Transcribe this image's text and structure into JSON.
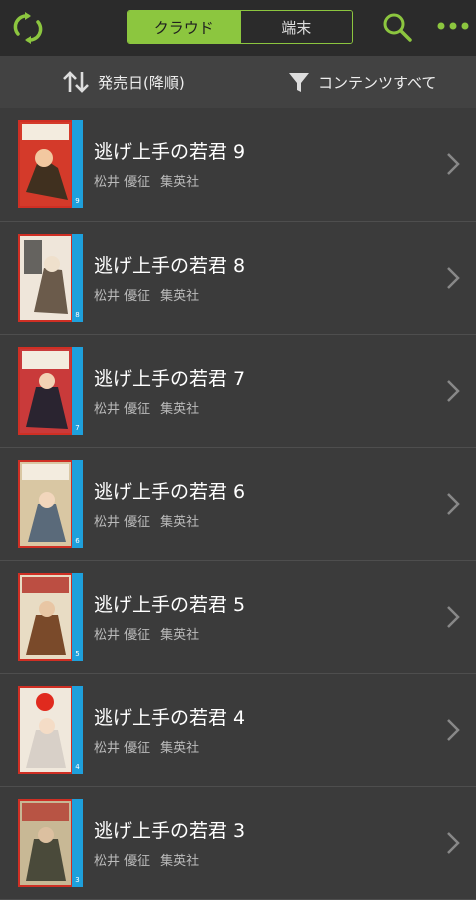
{
  "header": {
    "tabs": [
      {
        "label": "クラウド",
        "active": true
      },
      {
        "label": "端末",
        "active": false
      }
    ],
    "icons": [
      "sync-icon",
      "search-icon",
      "more-icon"
    ],
    "accent": "#8cc63f"
  },
  "sortbar": {
    "sort_label": "発売日(降順)",
    "filter_label": "コンテンツすべて"
  },
  "books": [
    {
      "title": "逃げ上手の若君 9",
      "author": "松井 優征",
      "publisher": "集英社",
      "volume": "9",
      "cover_color": "#d43a2a"
    },
    {
      "title": "逃げ上手の若君 8",
      "author": "松井 優征",
      "publisher": "集英社",
      "volume": "8",
      "cover_color": "#efe6da"
    },
    {
      "title": "逃げ上手の若君 7",
      "author": "松井 優征",
      "publisher": "集英社",
      "volume": "7",
      "cover_color": "#c93a3a"
    },
    {
      "title": "逃げ上手の若君 6",
      "author": "松井 優征",
      "publisher": "集英社",
      "volume": "6",
      "cover_color": "#d9c7a3"
    },
    {
      "title": "逃げ上手の若君 5",
      "author": "松井 優征",
      "publisher": "集英社",
      "volume": "5",
      "cover_color": "#e8dcc4"
    },
    {
      "title": "逃げ上手の若君 4",
      "author": "松井 優征",
      "publisher": "集英社",
      "volume": "4",
      "cover_color": "#f0e8dc"
    },
    {
      "title": "逃げ上手の若君 3",
      "author": "松井 優征",
      "publisher": "集英社",
      "volume": "3",
      "cover_color": "#c8b895"
    }
  ]
}
